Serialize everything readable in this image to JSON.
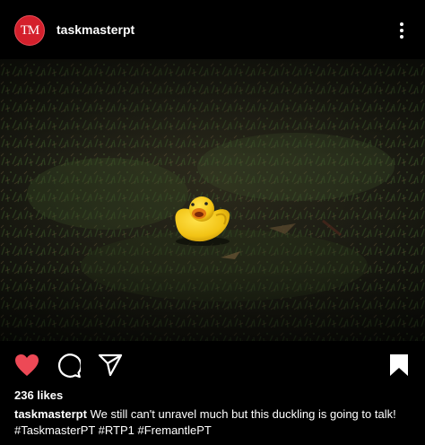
{
  "post": {
    "avatar_text": "TM",
    "username": "taskmasterpt",
    "likes": "236 likes",
    "caption_user": "taskmasterpt",
    "caption_text": "We still can't unravel much but this duckling is going to talk!",
    "hashtags": "#TaskmasterPT #RTP1 #FremantlePT"
  },
  "icons": {
    "more": "more-vertical-icon",
    "like": "heart-filled-icon",
    "comment": "comment-bubble-icon",
    "share": "send-paper-plane-icon",
    "save": "bookmark-filled-icon"
  },
  "colors": {
    "background": "#000000",
    "avatar": "#d4202c",
    "liked_heart": "#ed4956",
    "text": "#ffffff"
  }
}
